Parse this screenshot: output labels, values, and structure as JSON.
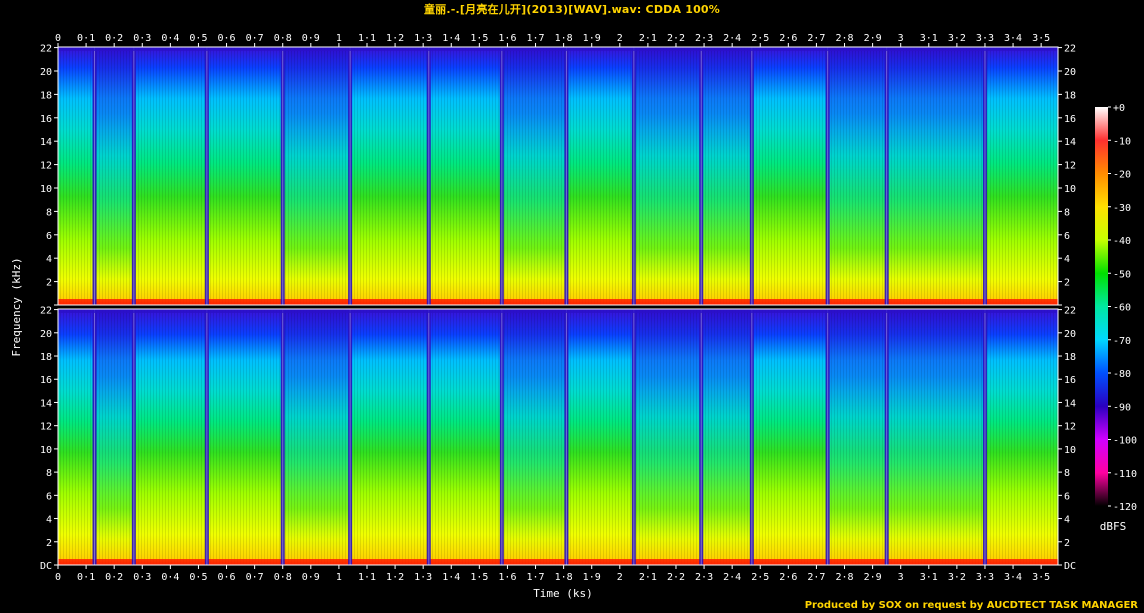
{
  "title": "童丽.-.[月亮在儿开](2013)[WAV].wav: CDDA 100%",
  "footer": "Produced by SOX on request by AUCDTECT TASK MANAGER",
  "chart_data": {
    "type": "heatmap",
    "subtype": "spectrogram",
    "channels": 2,
    "xlabel": "Time (ks)",
    "ylabel": "Frequency (kHz)",
    "xlim": [
      0,
      3.56
    ],
    "ylim": [
      0,
      22.05
    ],
    "x_ticks": [
      "0",
      "0·1",
      "0·2",
      "0·3",
      "0·4",
      "0·5",
      "0·6",
      "0·7",
      "0·8",
      "0·9",
      "1",
      "1·1",
      "1·2",
      "1·3",
      "1·4",
      "1·5",
      "1·6",
      "1·7",
      "1·8",
      "1·9",
      "2",
      "2·1",
      "2·2",
      "2·3",
      "2·4",
      "2·5",
      "2·6",
      "2·7",
      "2·8",
      "2·9",
      "3",
      "3·1",
      "3·2",
      "3·3",
      "3·4",
      "3·5"
    ],
    "x_tick_values": [
      0,
      0.1,
      0.2,
      0.3,
      0.4,
      0.5,
      0.6,
      0.7,
      0.8,
      0.9,
      1.0,
      1.1,
      1.2,
      1.3,
      1.4,
      1.5,
      1.6,
      1.7,
      1.8,
      1.9,
      2.0,
      2.1,
      2.2,
      2.3,
      2.4,
      2.5,
      2.6,
      2.7,
      2.8,
      2.9,
      3.0,
      3.1,
      3.2,
      3.3,
      3.4,
      3.5
    ],
    "y_ticks": [
      "DC",
      "2",
      "4",
      "6",
      "8",
      "10",
      "12",
      "14",
      "16",
      "18",
      "20",
      "22"
    ],
    "y_tick_values": [
      0,
      2,
      4,
      6,
      8,
      10,
      12,
      14,
      16,
      18,
      20,
      22
    ],
    "colorbar_label": "dBFS",
    "colorbar_ticks": [
      "+0",
      "-10",
      "-20",
      "-30",
      "-40",
      "-50",
      "-60",
      "-70",
      "-80",
      "-90",
      "-100",
      "-110",
      "-120"
    ],
    "colorbar_values": [
      0,
      -10,
      -20,
      -30,
      -40,
      -50,
      -60,
      -70,
      -80,
      -90,
      -100,
      -110,
      -120
    ],
    "colormap": [
      "#ffffff",
      "#ff3030",
      "#ff8c00",
      "#ffe000",
      "#c8ff00",
      "#00e000",
      "#00e8a0",
      "#00d8ff",
      "#0050ff",
      "#2a00c0",
      "#d000ff",
      "#ff00a0",
      "#000000"
    ],
    "track_boundaries_ks": [
      0.13,
      0.27,
      0.53,
      0.8,
      1.04,
      1.32,
      1.58,
      1.81,
      2.05,
      2.29,
      2.47,
      2.74,
      2.95,
      3.3
    ]
  }
}
